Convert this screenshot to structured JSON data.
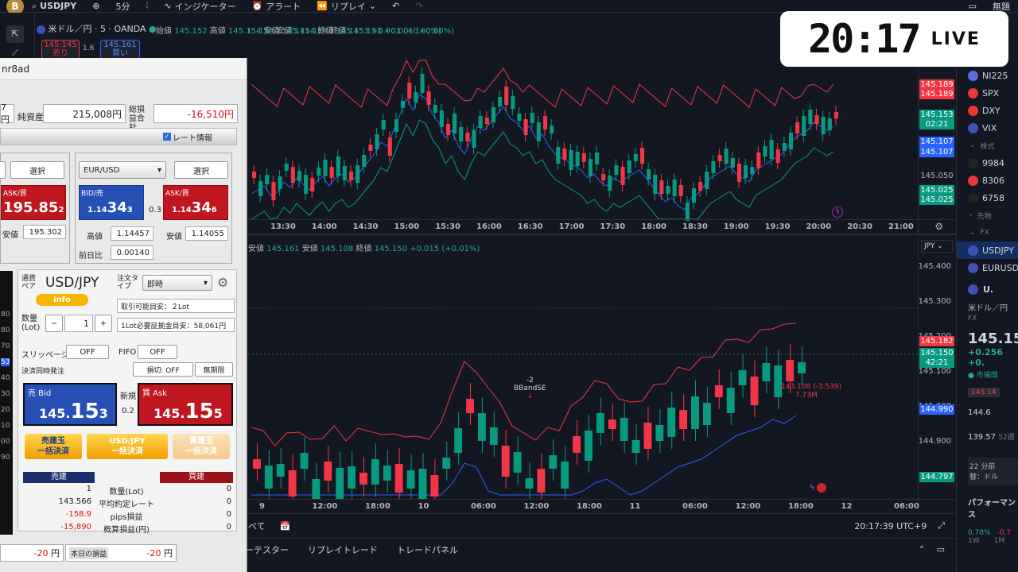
{
  "topbar": {
    "symbol": "USDJPY",
    "interval": "5分",
    "indicators": "インジケーター",
    "alert": "アラート",
    "replay": "リプレイ",
    "layout_name": "無題"
  },
  "chartA": {
    "title": "米ドル／円 · 5 · OANDA",
    "sell_price": "145.145",
    "sell_label": "売り",
    "spread": "1.6",
    "buy_price": "145.161",
    "buy_label": "買い",
    "ohlc": {
      "o_label": "始値",
      "o": "145.152",
      "h_label": "高値",
      "h": "145.154",
      "l_label": "安値",
      "l": "145.114",
      "c_label": "終値",
      "c": "145.153",
      "chg": "+0.001 (+0.00%)"
    },
    "price_tags": [
      {
        "value": "145.189",
        "color": "#f23645"
      },
      {
        "value": "145.189",
        "color": "#f23645"
      },
      {
        "value": "145.153",
        "color": "#089981"
      },
      {
        "value": "02:21",
        "color": "#089981"
      },
      {
        "value": "145.107",
        "color": "#2962ff"
      },
      {
        "value": "145.107",
        "color": "#2962ff"
      },
      {
        "value": "145.050",
        "color": ""
      },
      {
        "value": "145.025",
        "color": "#089981"
      },
      {
        "value": "145.025",
        "color": "#089981"
      }
    ],
    "time_ticks": [
      "13:30",
      "14:00",
      "14:30",
      "15:00",
      "15:30",
      "16:00",
      "16:30",
      "17:00",
      "17:30",
      "18:00",
      "18:30",
      "19:00",
      "19:30",
      "20:00",
      "20:30",
      "21:00"
    ]
  },
  "chartB": {
    "ohlc": {
      "l_label": "安値",
      "l": "145.161",
      "l2_label": "安値",
      "l2": "145.108",
      "c_label": "終値",
      "c": "145.150",
      "chg": "+0.015 (+0.01%)"
    },
    "currency": "JPY",
    "axis": [
      "145.400",
      "145.300",
      "145.200",
      "145.100",
      "145.000",
      "144.900",
      "144.800"
    ],
    "price_tags": [
      {
        "value": "145.182",
        "color": "#f23645"
      },
      {
        "value": "145.150",
        "color": "#089981"
      },
      {
        "value": "42:21",
        "color": "#089981"
      },
      {
        "value": "144.990",
        "color": "#2962ff"
      },
      {
        "value": "144.797",
        "color": "#089981"
      }
    ],
    "annotation_sig": "-2",
    "annotation_name": "BBandSE",
    "annotation_val": "143.108 (-3.539)",
    "annotation_vol": "7.73M",
    "time_ticks": [
      "9",
      "12:00",
      "18:00",
      "10",
      "06:00",
      "12:00",
      "18:00",
      "11",
      "06:00",
      "12:00",
      "18:00",
      "12",
      "06:00"
    ]
  },
  "bottombar": {
    "all": "べて",
    "timestamp": "20:17:39 UTC+9",
    "tabs": [
      "ーテスター",
      "リプレイトレード",
      "トレードパネル"
    ]
  },
  "clock": {
    "time": "20:17",
    "live": "LIVE"
  },
  "watchlist": {
    "items": [
      {
        "name": "NI225",
        "color": "#5b6ee1"
      },
      {
        "name": "SPX",
        "color": "#e53935"
      },
      {
        "name": "DXY",
        "color": "#e53935"
      },
      {
        "name": "VIX",
        "color": "#3f51b5"
      }
    ],
    "stock_section": "株式",
    "stocks": [
      {
        "name": "9984",
        "color": "#222"
      },
      {
        "name": "8306",
        "color": "#e53935"
      },
      {
        "name": "6758",
        "color": "#222"
      }
    ],
    "futures_section": "先物",
    "fx_section": "FX",
    "fx": [
      {
        "name": "USDJPY",
        "color": "#3f51b5"
      },
      {
        "name": "EURUSD",
        "color": "#3f51b5"
      }
    ],
    "detail_name": "U.",
    "detail_sub": "米ドル／円",
    "detail_cat": "FX",
    "detail_price": "145.15",
    "detail_chg": "+0.256",
    "detail_chg2": "+0.",
    "detail_status": "市場開",
    "detail_low_tag": "145.14",
    "detail_v1": "144.6",
    "detail_v2": "139.57",
    "detail_v3": "52週",
    "detail_news_time": "22 分前",
    "detail_news": "替：ドル",
    "perf": "パフォーマンス",
    "perf_v1": "0.78%",
    "perf_v2": "-0.7",
    "perf_l1": "1W",
    "perf_l2": "1M"
  },
  "panel": {
    "title": "nr8ad",
    "nav_label": "純資産",
    "nav_value": "215,008円",
    "left_value": "7円",
    "pl_label": "総損益合計",
    "pl_value": "-16,510円",
    "rate_info": "レート情報",
    "select": "選択",
    "pair1_ask_label": "ASK/買",
    "pair1_ask_big": "195.85",
    "pair1_ask_small": "2",
    "pair1_low_label": "安値",
    "pair1_low": "195.302",
    "pair2": "EUR/USD",
    "pair2_bid_label": "BID/売",
    "pair2_bid_pre": "1.14",
    "pair2_bid_big": "34",
    "pair2_bid_small": "3",
    "pair2_spread": "0.3",
    "pair2_ask_label": "ASK/買",
    "pair2_ask_pre": "1.14",
    "pair2_ask_big": "34",
    "pair2_ask_small": "6",
    "pair2_high_label": "高値",
    "pair2_high": "1.14457",
    "pair2_low_label": "安値",
    "pair2_low": "1.14055",
    "pair2_prev_label": "前日比",
    "pair2_prev": "0.00140",
    "order_pair_label": "通貨ペア",
    "order_pair": "USD/JPY",
    "info": "info",
    "order_type_label": "注文タイプ",
    "order_type": "即時",
    "available": "取引可能目安：２Lot",
    "margin": "1Lot必要証拠金目安：58,061円",
    "qty_label": "数量(Lot)",
    "qty": "1",
    "slippage": "スリッページ",
    "off": "OFF",
    "fifo": "FIFO",
    "simul": "決済同時発注",
    "stoploss": "損切: OFF",
    "expiry": "無期限",
    "sell_bid_label": "売 Bid",
    "sell_pre": "145.",
    "sell_big": "15",
    "sell_small": "3",
    "new_label": "新規",
    "spread": "0.2",
    "buy_ask_label": "買 Ask",
    "buy_pre": "145.",
    "buy_big": "15",
    "buy_small": "5",
    "close_sell": "売建玉一括決済",
    "close_pair": "USD/JPY一括決済",
    "close_buy": "買建玉一括決済",
    "sell_pos": "売建",
    "buy_pos": "買建",
    "rows": [
      {
        "sell": "1",
        "label": "数量(Lot)",
        "buy": "0"
      },
      {
        "sell": "143.566",
        "label": "平均約定レート",
        "buy": "0"
      },
      {
        "sell": "-158.9",
        "label": "pips損益",
        "buy": "0"
      },
      {
        "sell": "-15,890",
        "label": "概算損益(円)",
        "buy": "0"
      }
    ],
    "left_side": [
      "80",
      "80",
      "70",
      "53",
      "40",
      "30",
      "20",
      "10",
      "00",
      "90"
    ],
    "foot_left": "-20",
    "foot_yen": "円",
    "today_label": "本日の損益",
    "today_value": "-20"
  }
}
